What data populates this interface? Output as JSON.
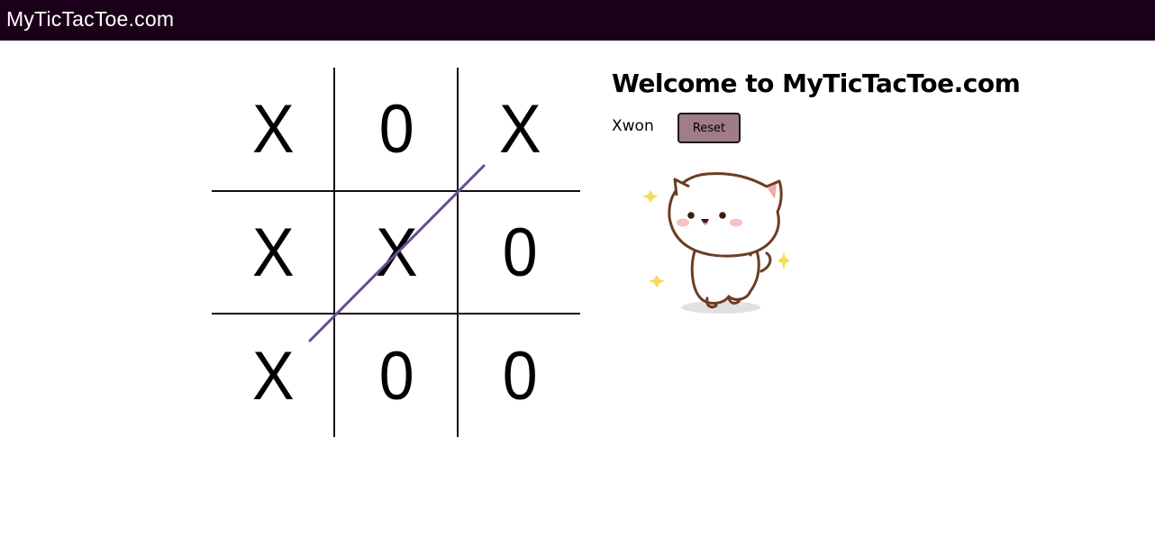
{
  "header": {
    "site_title": "MyTicTacToe.com"
  },
  "board": {
    "cells": [
      "X",
      "0",
      "X",
      "X",
      "X",
      "0",
      "X",
      "0",
      "0"
    ],
    "winning_line": "diagonal-bottom-left-to-top-right",
    "winning_line_color": "#6b4a96"
  },
  "panel": {
    "welcome": "Welcome to MyTicTacToe.com",
    "status": "Xwon",
    "reset_label": "Reset"
  },
  "colors": {
    "topbar_bg": "#1b0019",
    "reset_bg": "#a07b88"
  },
  "icons": {
    "celebration": "happy-cat-sticker"
  }
}
